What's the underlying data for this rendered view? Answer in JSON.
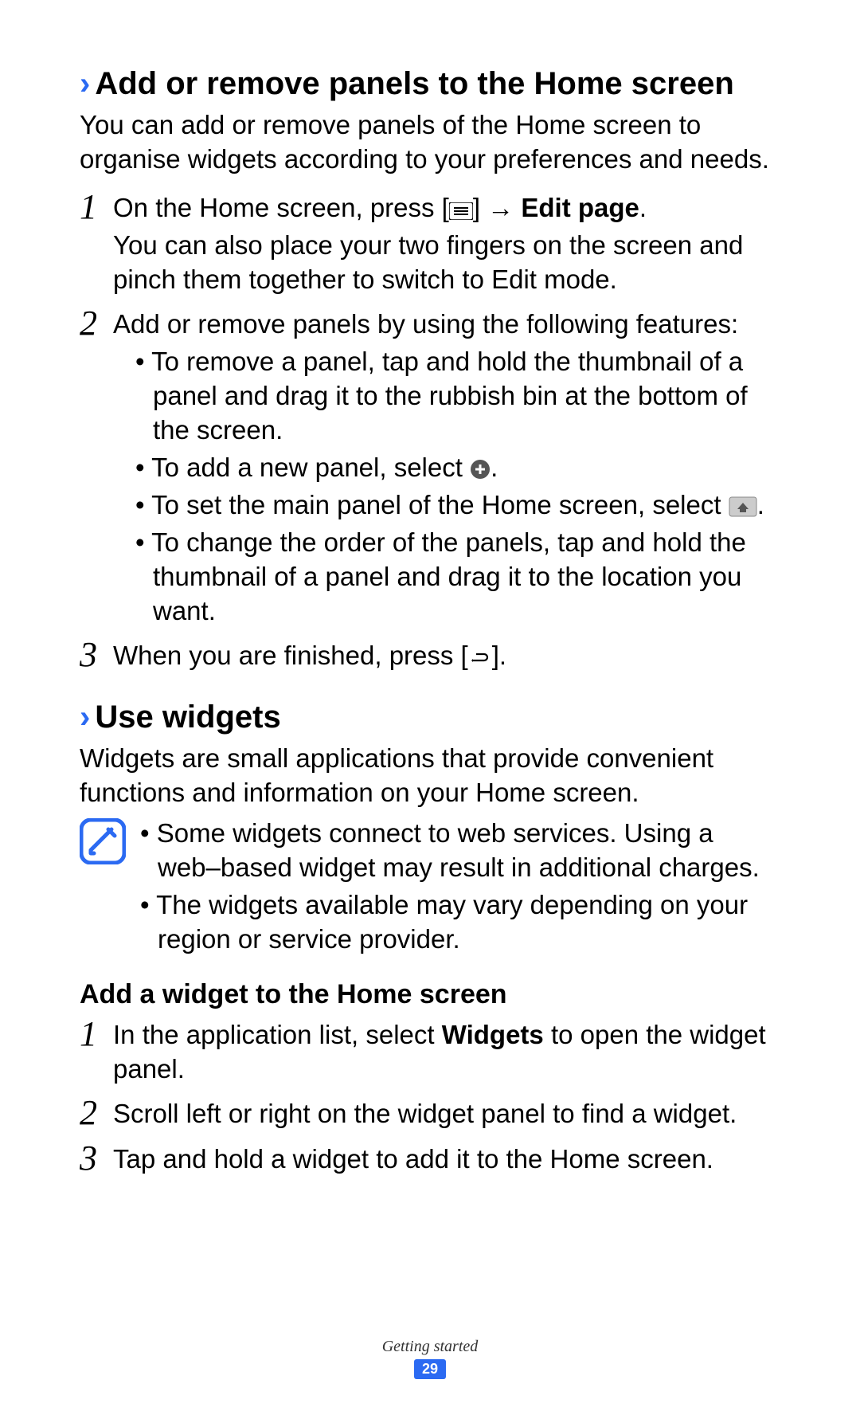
{
  "section1": {
    "title": "Add or remove panels to the Home screen",
    "intro": "You can add or remove panels of the Home screen to organise widgets according to your preferences and needs.",
    "step1": {
      "line1a": "On the Home screen, press [",
      "line1b": "] → ",
      "line1_bold": "Edit page",
      "line1c": ".",
      "line2": "You can also place your two fingers on the screen and pinch them together to switch to Edit mode."
    },
    "step2": {
      "intro": "Add or remove panels by using the following features:",
      "b1": "To remove a panel, tap and hold the thumbnail of a panel and drag it to the rubbish bin at the bottom of the screen.",
      "b2a": "To add a new panel, select ",
      "b2b": ".",
      "b3a": "To set the main panel of the Home screen, select ",
      "b3b": ".",
      "b4": "To change the order of the panels, tap and hold the thumbnail of a panel and drag it to the location you want."
    },
    "step3": {
      "a": "When you are finished, press [",
      "b": "]."
    }
  },
  "section2": {
    "title": "Use widgets",
    "intro": "Widgets are small applications that provide convenient functions and information on your Home screen.",
    "note1": "Some widgets connect to web services. Using a web–based widget may result in additional charges.",
    "note2": "The widgets available may vary depending on your region or service provider."
  },
  "section3": {
    "title": "Add a widget to the Home screen",
    "step1a": "In the application list, select ",
    "step1_bold": "Widgets",
    "step1b": " to open the widget panel.",
    "step2": "Scroll left or right on the widget panel to find a widget.",
    "step3": "Tap and hold a widget to add it to the Home screen."
  },
  "footer": {
    "chapter": "Getting started",
    "page": "29"
  },
  "nums": {
    "n1": "1",
    "n2": "2",
    "n3": "3"
  }
}
